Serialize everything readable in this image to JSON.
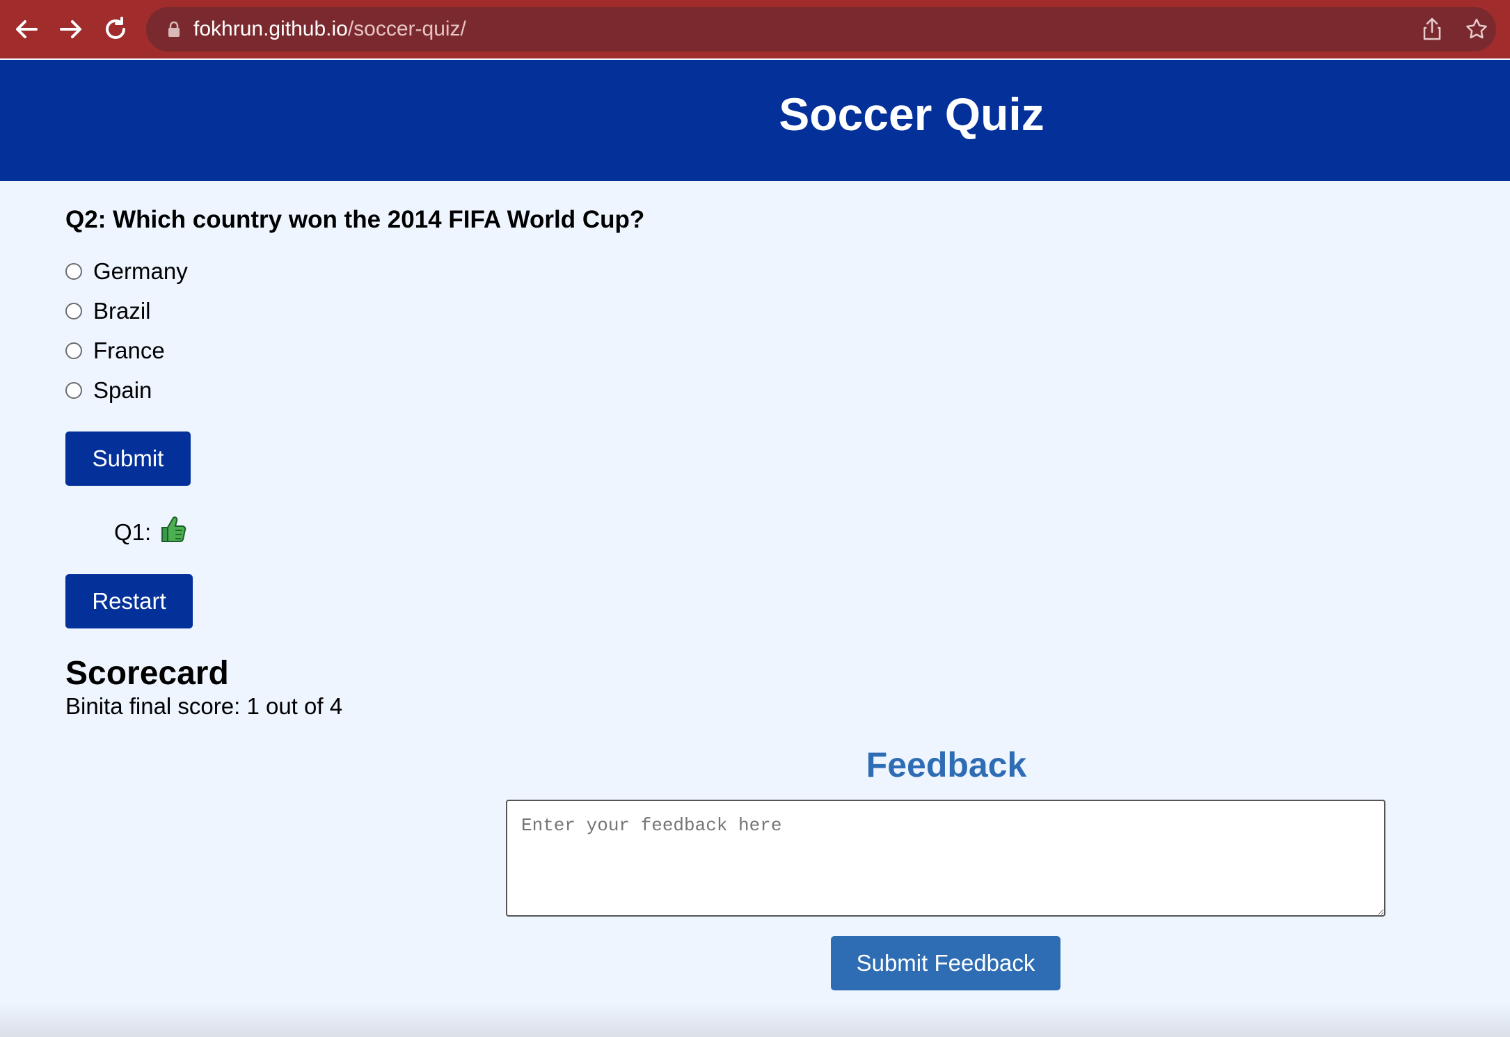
{
  "browser": {
    "url_host": "fokhrun.github.io",
    "url_path": "/soccer-quiz/"
  },
  "header": {
    "title": "Soccer Quiz"
  },
  "quiz": {
    "question": "Q2: Which country won the 2014 FIFA World Cup?",
    "options": [
      "Germany",
      "Brazil",
      "France",
      "Spain"
    ],
    "submit_label": "Submit",
    "result_label": "Q1:",
    "result_icon": "thumbs-up-icon",
    "restart_label": "Restart"
  },
  "scorecard": {
    "title": "Scorecard",
    "line": "Binita final score: 1 out of 4"
  },
  "feedback": {
    "title": "Feedback",
    "placeholder": "Enter your feedback here",
    "submit_label": "Submit Feedback"
  },
  "colors": {
    "chrome": "#a02c2c",
    "header": "#04309a",
    "feedback_accent": "#2e6db4",
    "background": "#eef5ff"
  }
}
